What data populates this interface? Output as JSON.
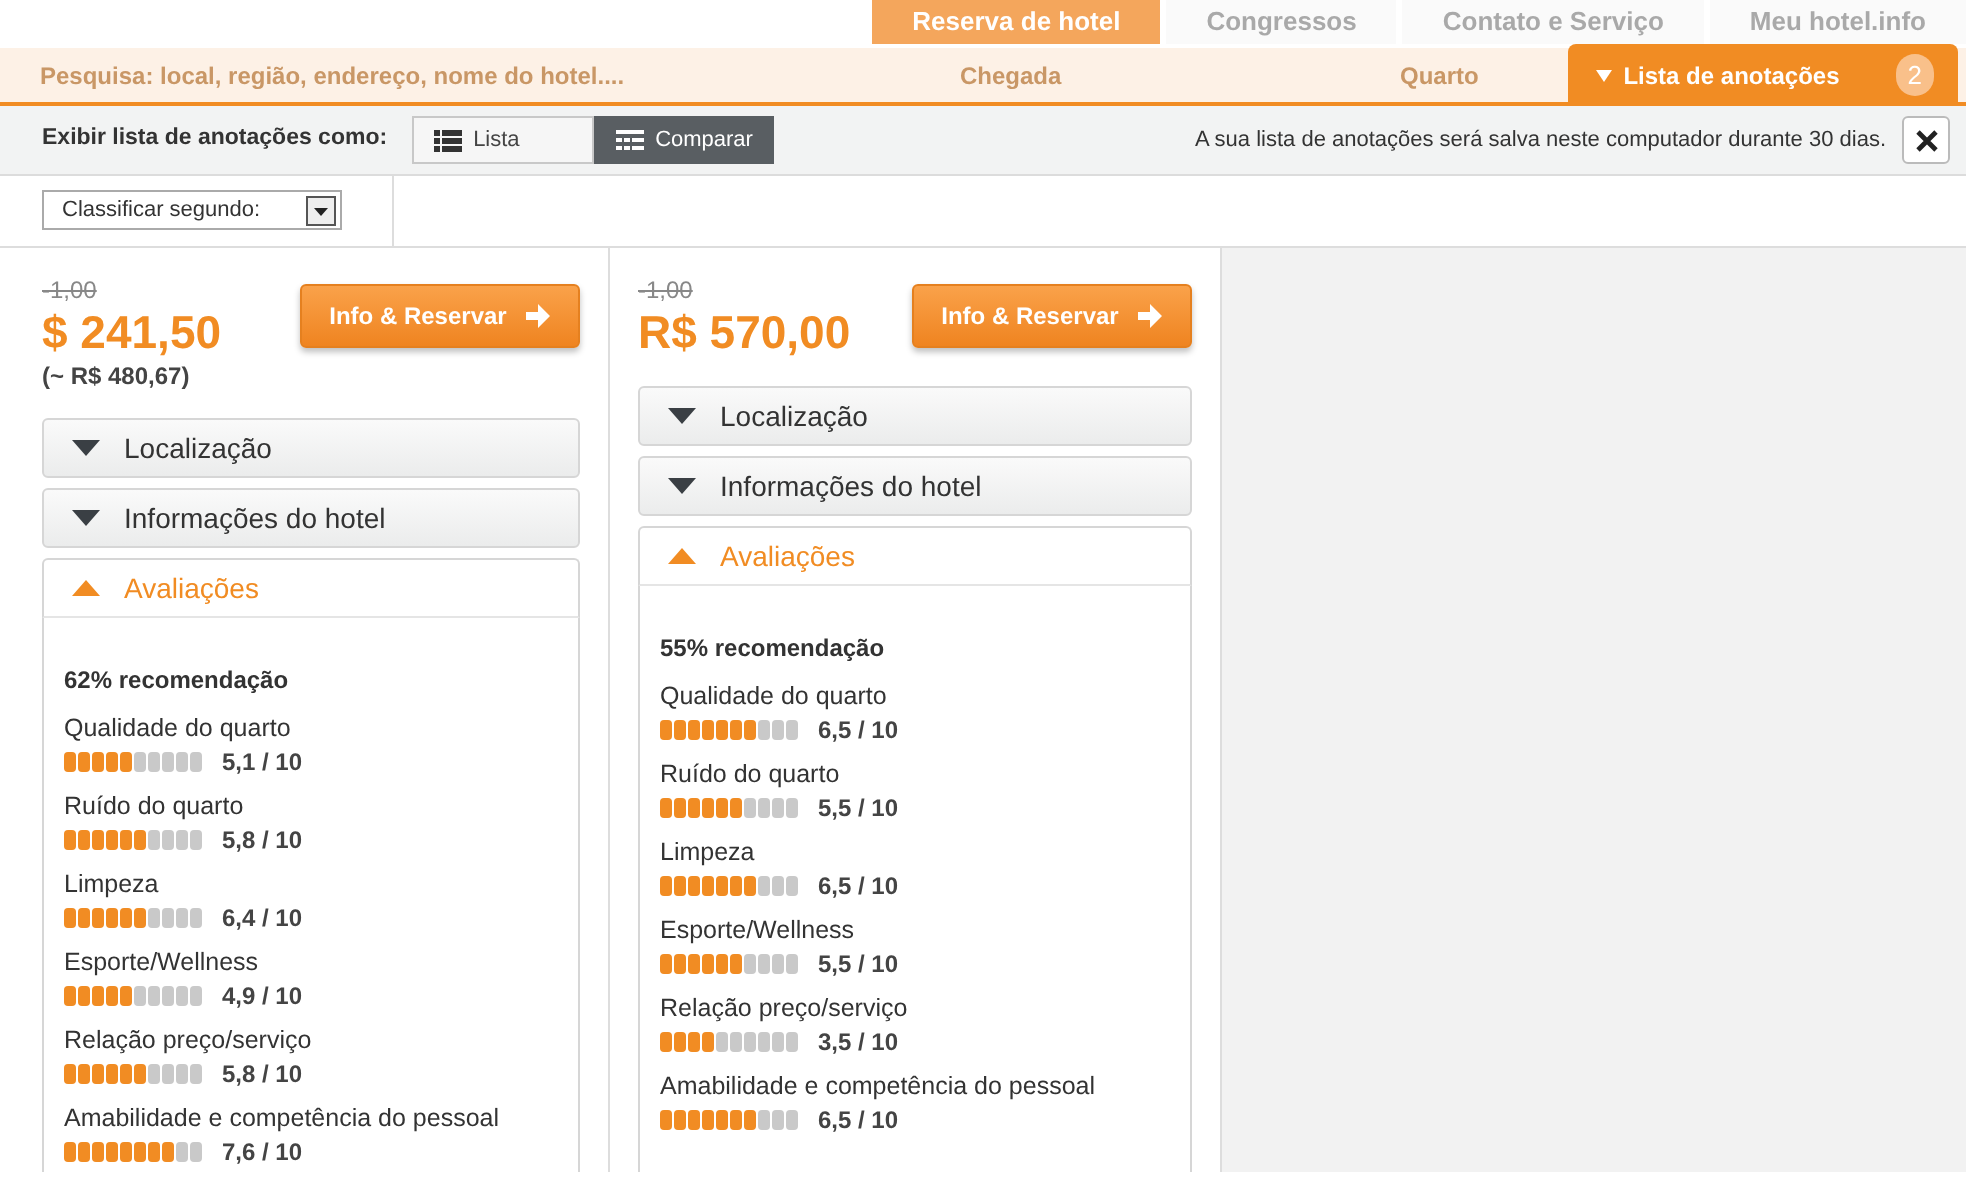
{
  "nav_tabs": [
    {
      "label": "Reserva de hotel",
      "selected": true
    },
    {
      "label": "Congressos",
      "selected": false
    },
    {
      "label": "Contato e Serviço",
      "selected": false
    },
    {
      "label": "Meu hotel.info",
      "selected": false
    }
  ],
  "search_bar": {
    "placeholder": "Pesquisa: local, região, endereço, nome do hotel....",
    "arrival": "Chegada",
    "room": "Quarto"
  },
  "notes_tab": {
    "label": "Lista de anotações",
    "count": "2",
    "expanded": true
  },
  "toolbar": {
    "label": "Exibir lista de anotações como:",
    "views": [
      {
        "label": "Lista",
        "kind": "list",
        "selected": false
      },
      {
        "label": "Comparar",
        "kind": "grid",
        "selected": true
      }
    ],
    "notice": "A sua lista de anotações será salva neste computador durante 30 dias."
  },
  "sort": {
    "label": "Classificar segundo:"
  },
  "hotels": [
    {
      "old_price": "-1,00",
      "price": "$ 241,50",
      "converted": "(~ R$ 480,67)",
      "button": "Info & Reservar",
      "sections": [
        {
          "title": "Localização",
          "expanded": false
        },
        {
          "title": "Informações do hotel",
          "expanded": false
        },
        {
          "title": "Avaliações",
          "expanded": true
        }
      ],
      "recommendation": "62% recomendação",
      "ratings": [
        {
          "label": "Qualidade do quarto",
          "level": 0.5,
          "score": "5,1 / 10"
        },
        {
          "label": "Ruído do quarto",
          "level": 0.6,
          "score": "5,8 / 10"
        },
        {
          "label": "Limpeza",
          "level": 0.6,
          "score": "6,4 / 10"
        },
        {
          "label": "Esporte/Wellness",
          "level": 0.5,
          "score": "4,9 / 10"
        },
        {
          "label": "Relação preço/serviço",
          "level": 0.6,
          "score": "5,8 / 10"
        },
        {
          "label": "Amabilidade e competência do pessoal",
          "level": 0.8,
          "score": "7,6 / 10"
        }
      ]
    },
    {
      "old_price": "-1,00",
      "price": "R$ 570,00",
      "button": "Info & Reservar",
      "sections": [
        {
          "title": "Localização",
          "expanded": false
        },
        {
          "title": "Informações do hotel",
          "expanded": false
        },
        {
          "title": "Avaliações",
          "expanded": true
        }
      ],
      "recommendation": "55% recomendação",
      "ratings": [
        {
          "label": "Qualidade do quarto",
          "level": 0.7,
          "score": "6,5 / 10"
        },
        {
          "label": "Ruído do quarto",
          "level": 0.6,
          "score": "5,5 / 10"
        },
        {
          "label": "Limpeza",
          "level": 0.7,
          "score": "6,5 / 10"
        },
        {
          "label": "Esporte/Wellness",
          "level": 0.6,
          "score": "5,5 / 10"
        },
        {
          "label": "Relação preço/serviço",
          "level": 0.4,
          "score": "3,5 / 10"
        },
        {
          "label": "Amabilidade e competência do pessoal",
          "level": 0.7,
          "score": "6,5 / 10"
        }
      ]
    }
  ]
}
